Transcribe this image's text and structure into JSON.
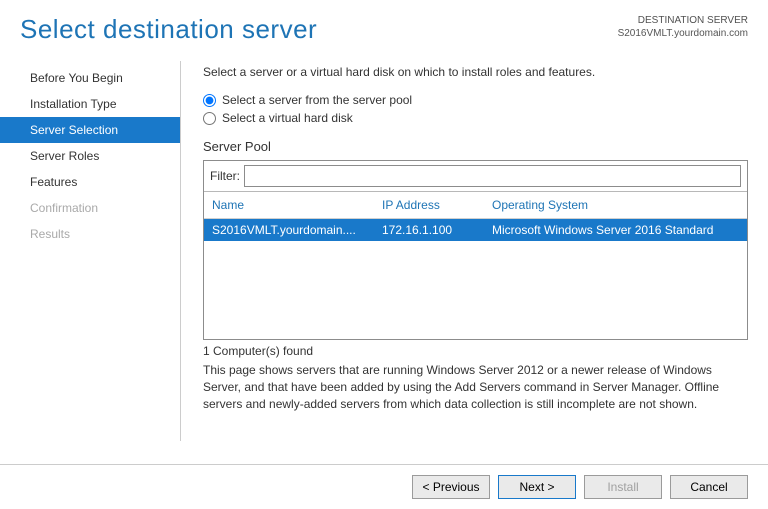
{
  "header": {
    "title": "Select destination server",
    "dest_label": "DESTINATION SERVER",
    "dest_value": "S2016VMLT.yourdomain.com"
  },
  "nav": {
    "items": [
      {
        "label": "Before You Begin",
        "state": "normal"
      },
      {
        "label": "Installation Type",
        "state": "normal"
      },
      {
        "label": "Server Selection",
        "state": "active"
      },
      {
        "label": "Server Roles",
        "state": "normal"
      },
      {
        "label": "Features",
        "state": "normal"
      },
      {
        "label": "Confirmation",
        "state": "disabled"
      },
      {
        "label": "Results",
        "state": "disabled"
      }
    ]
  },
  "main": {
    "instruction": "Select a server or a virtual hard disk on which to install roles and features.",
    "radio": {
      "option1": "Select a server from the server pool",
      "option2": "Select a virtual hard disk",
      "selected": 0
    },
    "server_pool_label": "Server Pool",
    "filter_label": "Filter:",
    "filter_value": "",
    "columns": {
      "name": "Name",
      "ip": "IP Address",
      "os": "Operating System"
    },
    "rows": [
      {
        "name": "S2016VMLT.yourdomain....",
        "ip": "172.16.1.100",
        "os": "Microsoft Windows Server 2016 Standard"
      }
    ],
    "found": "1 Computer(s) found",
    "description": "This page shows servers that are running Windows Server 2012 or a newer release of Windows Server, and that have been added by using the Add Servers command in Server Manager. Offline servers and newly-added servers from which data collection is still incomplete are not shown."
  },
  "footer": {
    "previous": "< Previous",
    "next": "Next >",
    "install": "Install",
    "cancel": "Cancel"
  }
}
